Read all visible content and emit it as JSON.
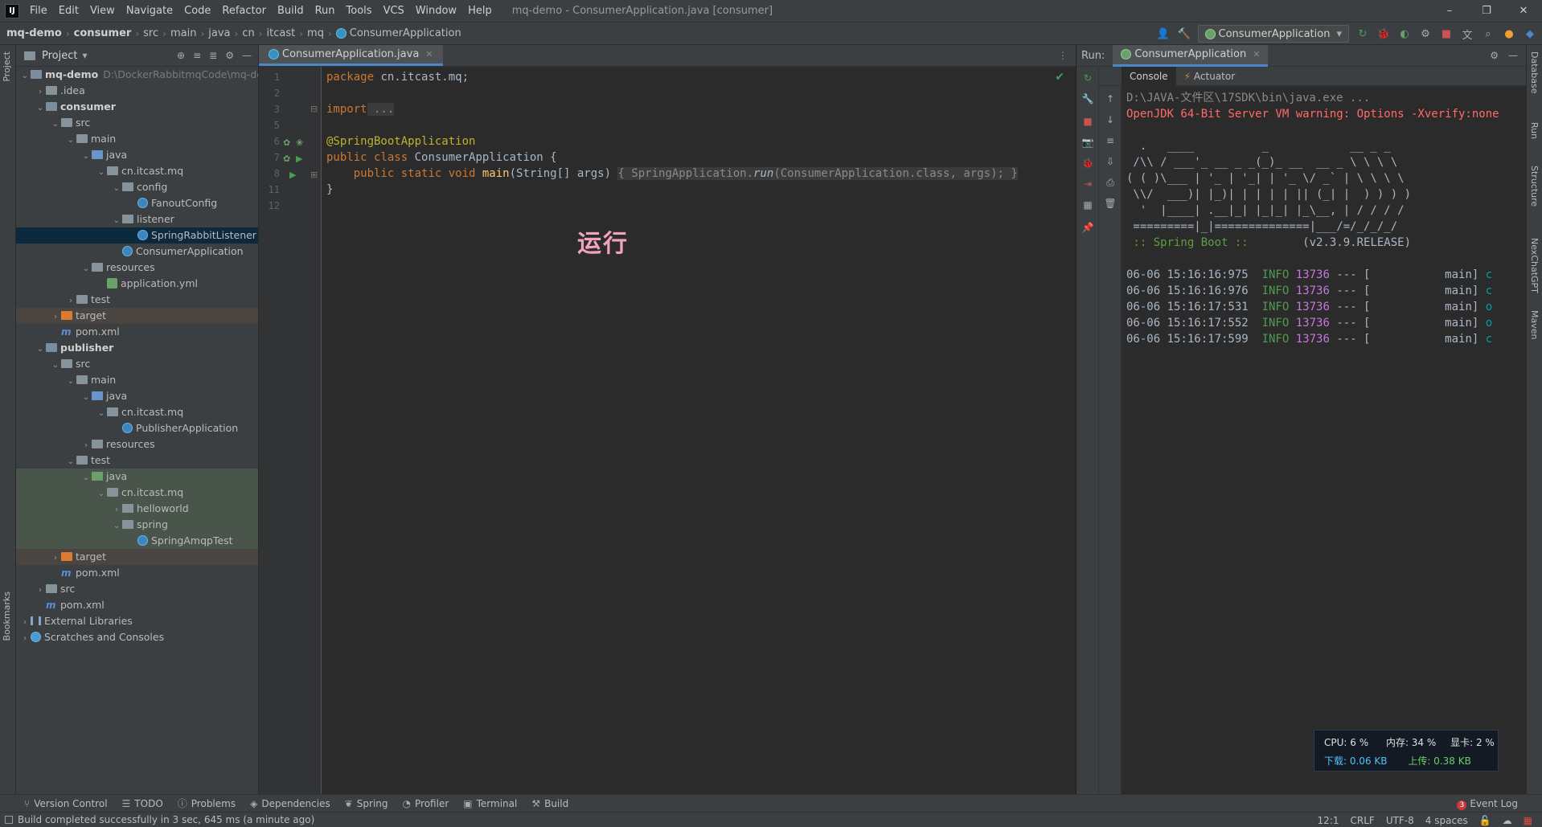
{
  "menubar": {
    "logo": "IJ",
    "items": [
      "File",
      "Edit",
      "View",
      "Navigate",
      "Code",
      "Refactor",
      "Build",
      "Run",
      "Tools",
      "VCS",
      "Window",
      "Help"
    ],
    "window_title": "mq-demo - ConsumerApplication.java [consumer]",
    "controls": [
      "–",
      "❐",
      "✕"
    ]
  },
  "breadcrumb": [
    "mq-demo",
    "consumer",
    "src",
    "main",
    "java",
    "cn",
    "itcast",
    "mq",
    "ConsumerApplication"
  ],
  "run_config": "ConsumerApplication",
  "left_stripe": {
    "project": "Project",
    "bookmarks": "Bookmarks"
  },
  "right_stripe": {
    "database": "Database",
    "run": "Run",
    "structure": "Structure",
    "nextchatgpt": "NexChatGPT",
    "maven": "Maven"
  },
  "project": {
    "title": "Project",
    "root_path": "D:\\DockerRabbitmqCode\\mq-de",
    "tree": [
      {
        "label": "mq-demo",
        "depth": 0,
        "kind": "module",
        "arrow": "v",
        "bold": true
      },
      {
        "label": ".idea",
        "depth": 1,
        "kind": "folder",
        "arrow": ">"
      },
      {
        "label": "consumer",
        "depth": 1,
        "kind": "module",
        "arrow": "v",
        "bold": true
      },
      {
        "label": "src",
        "depth": 2,
        "kind": "folder",
        "arrow": "v"
      },
      {
        "label": "main",
        "depth": 3,
        "kind": "folder",
        "arrow": "v"
      },
      {
        "label": "java",
        "depth": 4,
        "kind": "blue",
        "arrow": "v"
      },
      {
        "label": "cn.itcast.mq",
        "depth": 5,
        "kind": "folder",
        "arrow": "v"
      },
      {
        "label": "config",
        "depth": 6,
        "kind": "folder",
        "arrow": "v"
      },
      {
        "label": "FanoutConfig",
        "depth": 7,
        "kind": "java",
        "arrow": ""
      },
      {
        "label": "listener",
        "depth": 6,
        "kind": "folder",
        "arrow": "v"
      },
      {
        "label": "SpringRabbitListener",
        "depth": 7,
        "kind": "java",
        "arrow": "",
        "selected": true
      },
      {
        "label": "ConsumerApplication",
        "depth": 6,
        "kind": "java",
        "arrow": ""
      },
      {
        "label": "resources",
        "depth": 4,
        "kind": "folder",
        "arrow": "v"
      },
      {
        "label": "application.yml",
        "depth": 5,
        "kind": "yml",
        "arrow": ""
      },
      {
        "label": "test",
        "depth": 3,
        "kind": "folder",
        "arrow": ">"
      },
      {
        "label": "target",
        "depth": 2,
        "kind": "orange",
        "arrow": ">",
        "hl": "target"
      },
      {
        "label": "pom.xml",
        "depth": 2,
        "kind": "maven",
        "arrow": ""
      },
      {
        "label": "publisher",
        "depth": 1,
        "kind": "module",
        "arrow": "v",
        "bold": true
      },
      {
        "label": "src",
        "depth": 2,
        "kind": "folder",
        "arrow": "v"
      },
      {
        "label": "main",
        "depth": 3,
        "kind": "folder",
        "arrow": "v"
      },
      {
        "label": "java",
        "depth": 4,
        "kind": "blue",
        "arrow": "v"
      },
      {
        "label": "cn.itcast.mq",
        "depth": 5,
        "kind": "folder",
        "arrow": "v"
      },
      {
        "label": "PublisherApplication",
        "depth": 6,
        "kind": "java",
        "arrow": ""
      },
      {
        "label": "resources",
        "depth": 4,
        "kind": "folder",
        "arrow": ">"
      },
      {
        "label": "test",
        "depth": 3,
        "kind": "folder",
        "arrow": "v"
      },
      {
        "label": "java",
        "depth": 4,
        "kind": "green",
        "arrow": "v",
        "hl": "test"
      },
      {
        "label": "cn.itcast.mq",
        "depth": 5,
        "kind": "folder",
        "arrow": "v",
        "hl": "test"
      },
      {
        "label": "helloworld",
        "depth": 6,
        "kind": "folder",
        "arrow": ">",
        "hl": "test"
      },
      {
        "label": "spring",
        "depth": 6,
        "kind": "folder",
        "arrow": "v",
        "hl": "test"
      },
      {
        "label": "SpringAmqpTest",
        "depth": 7,
        "kind": "java",
        "arrow": "",
        "hl": "test"
      },
      {
        "label": "target",
        "depth": 2,
        "kind": "orange",
        "arrow": ">",
        "hl": "target"
      },
      {
        "label": "pom.xml",
        "depth": 2,
        "kind": "maven",
        "arrow": ""
      },
      {
        "label": "src",
        "depth": 1,
        "kind": "folder",
        "arrow": ">"
      },
      {
        "label": "pom.xml",
        "depth": 1,
        "kind": "maven",
        "arrow": ""
      },
      {
        "label": "External Libraries",
        "depth": 0,
        "kind": "lib",
        "arrow": ">"
      },
      {
        "label": "Scratches and Consoles",
        "depth": 0,
        "kind": "scratch",
        "arrow": ">"
      }
    ]
  },
  "editor": {
    "tab": "ConsumerApplication.java",
    "line_numbers": [
      "1",
      "2",
      "3",
      "5",
      "6",
      "7",
      "8",
      "11",
      "12"
    ],
    "code": {
      "l1_kw": "package",
      "l1_rest": " cn.itcast.mq;",
      "l3_kw": "import",
      "l3_fold": " ...",
      "l6": "@SpringBootApplication",
      "l7_kw": "public class",
      "l7_rest": " ConsumerApplication {",
      "l8_kw": "    public static void",
      "l8_fn": " main",
      "l8_a": "(String[] args) ",
      "l8_b": "{ SpringApplication.",
      "l8_run": "run",
      "l8_c": "(ConsumerApplication.",
      "l8_cls": "class",
      "l8_d": ", args); }",
      "l11": "}"
    },
    "overlay_label": "运行"
  },
  "run": {
    "label": "Run:",
    "tab": "ConsumerApplication",
    "console_tab": "Console",
    "actuator_tab": "Actuator",
    "lines": {
      "cmd": "D:\\JAVA-文件区\\17SDK\\bin\\java.exe ...",
      "warn": "OpenJDK 64-Bit Server VM warning: Options -Xverify:none",
      "b1": "  .   ____          _            __ _ _",
      "b2": " /\\\\ / ___'_ __ _ _(_)_ __  __ _ \\ \\ \\ \\",
      "b3": "( ( )\\___ | '_ | '_| | '_ \\/ _` | \\ \\ \\ \\",
      "b4": " \\\\/  ___)| |_)| | | | | || (_| |  ) ) ) )",
      "b5": "  '  |____| .__|_| |_|_| |_\\__, | / / / /",
      "b6": " =========|_|==============|___/=/_/_/_/",
      "b7a": " :: Spring Boot :: ",
      "b7b": "       (v2.3.9.RELEASE)",
      "logs": [
        {
          "ts": "06-06 15:16:16:975",
          "lvl": "INFO",
          "pid": "13736",
          "rest": " --- [           main] ",
          "tail": "c"
        },
        {
          "ts": "06-06 15:16:16:976",
          "lvl": "INFO",
          "pid": "13736",
          "rest": " --- [           main] ",
          "tail": "c"
        },
        {
          "ts": "06-06 15:16:17:531",
          "lvl": "INFO",
          "pid": "13736",
          "rest": " --- [           main] ",
          "tail": "o"
        },
        {
          "ts": "06-06 15:16:17:552",
          "lvl": "INFO",
          "pid": "13736",
          "rest": " --- [           main] ",
          "tail": "o"
        },
        {
          "ts": "06-06 15:16:17:599",
          "lvl": "INFO",
          "pid": "13736",
          "rest": " --- [           main] ",
          "tail": "c"
        }
      ]
    }
  },
  "perf": {
    "cpu": "CPU: 6 %",
    "mem": "内存: 34 %",
    "gpu": "显卡: 2 %",
    "down": "下载: 0.06 KB",
    "up": "上传: 0.38 KB"
  },
  "bottom_tools": [
    "Version Control",
    "TODO",
    "Problems",
    "Dependencies",
    "Spring",
    "Profiler",
    "Terminal",
    "Build"
  ],
  "event_log": {
    "count": "3",
    "label": "Event Log"
  },
  "status": {
    "message": "Build completed successfully in 3 sec, 645 ms (a minute ago)",
    "position": "12:1",
    "line_sep": "CRLF",
    "encoding": "UTF-8",
    "indent": "4 spaces"
  },
  "colors": {
    "accent": "#4a88c7",
    "bg": "#2b2b2b",
    "panel": "#3c3f41",
    "selection": "#0d293e"
  }
}
